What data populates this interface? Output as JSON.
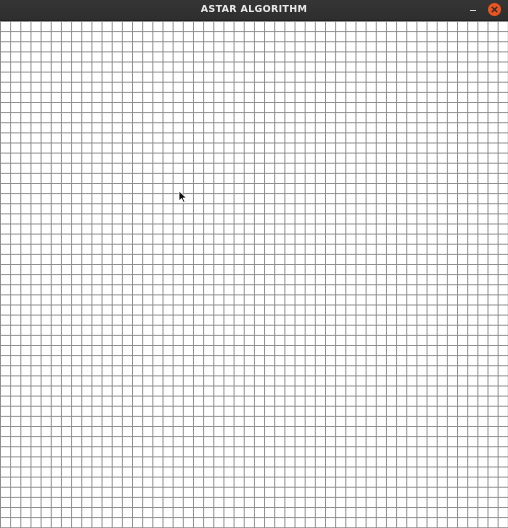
{
  "window": {
    "title": "ASTAR ALGORITHM"
  },
  "controls": {
    "minimize_icon": "minimize-icon",
    "close_icon": "close-icon",
    "close_color": "#e95420"
  },
  "grid": {
    "columns": 50,
    "rows": 50,
    "line_color": "#8c8c8c",
    "background_color": "#ffffff"
  }
}
